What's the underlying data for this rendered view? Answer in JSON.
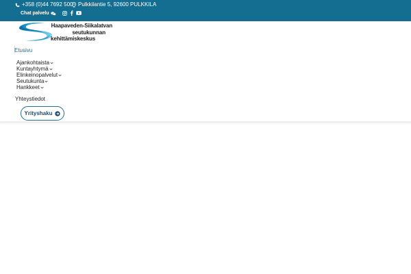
{
  "topbar": {
    "phone": "+358 (0)44 7692 500",
    "address": "Pulkkilantie 5, 92600 PULKKILA",
    "chat_label": "Chat palvelu",
    "social": [
      "instagram-icon",
      "facebook-icon",
      "youtube-icon"
    ],
    "background_color": "#136e91"
  },
  "logo": {
    "line1": "Haapaveden-Siikalatvan",
    "line2": "seutukunnan",
    "line3": "kehittämiskeskus"
  },
  "nav": {
    "home": "Etusivu",
    "items": [
      {
        "label": "Ajankohtaista",
        "has_submenu": true
      },
      {
        "label": "Kuntayhtymä",
        "has_submenu": true
      },
      {
        "label": "Elinkeinopalvelut",
        "has_submenu": true
      },
      {
        "label": "Seutukunta",
        "has_submenu": true
      },
      {
        "label": "Hankkeet",
        "has_submenu": true
      }
    ],
    "contact": "Yhteystiedot",
    "cta_label": "Yrityshaku",
    "accent_color": "#1e6f90"
  }
}
